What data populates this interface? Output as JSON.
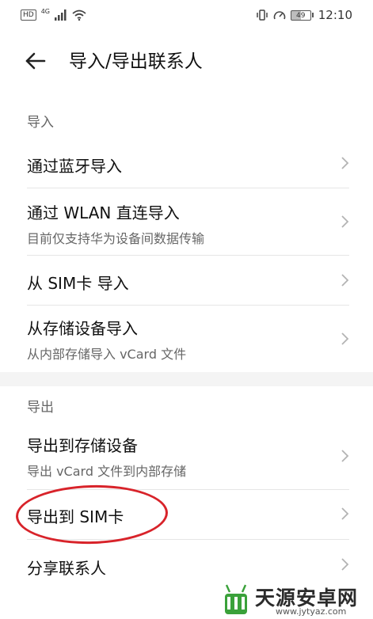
{
  "status_bar": {
    "hd": "HD",
    "network": "4G",
    "battery_level": "49",
    "time": "12:10"
  },
  "header": {
    "title": "导入/导出联系人"
  },
  "import_section": {
    "label": "导入",
    "items": [
      {
        "title": "通过蓝牙导入",
        "subtitle": ""
      },
      {
        "title": "通过 WLAN 直连导入",
        "subtitle": "目前仅支持华为设备间数据传输"
      },
      {
        "title": "从 SIM卡 导入",
        "subtitle": ""
      },
      {
        "title": "从存储设备导入",
        "subtitle": "从内部存储导入 vCard 文件"
      }
    ]
  },
  "export_section": {
    "label": "导出",
    "items": [
      {
        "title": "导出到存储设备",
        "subtitle": "导出 vCard 文件到内部存储"
      },
      {
        "title": "导出到 SIM卡",
        "subtitle": ""
      },
      {
        "title": "分享联系人",
        "subtitle": ""
      }
    ]
  },
  "watermark": {
    "name": "天源安卓网",
    "url": "www.jytyaz.com"
  },
  "colors": {
    "highlight": "#d8232a",
    "logo_green": "#3aa13a"
  }
}
